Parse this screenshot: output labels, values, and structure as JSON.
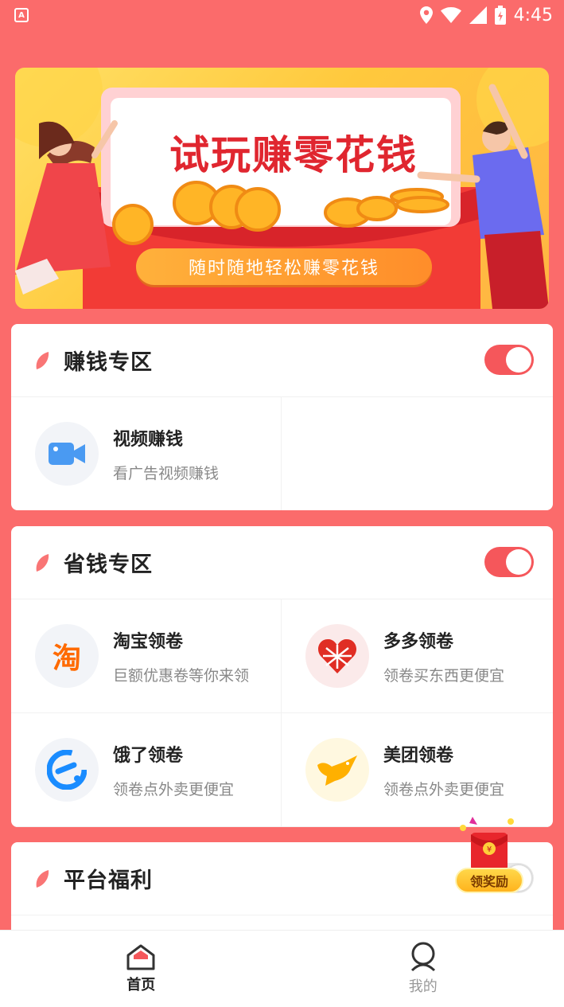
{
  "status_bar": {
    "time": "4:45",
    "app_badge": "A"
  },
  "banner": {
    "title": "试玩赚零花钱",
    "subtitle": "随时随地轻松赚零花钱"
  },
  "sections": [
    {
      "title": "赚钱专区",
      "toggle_on": true,
      "items": [
        {
          "title": "视频赚钱",
          "subtitle": "看广告视频赚钱",
          "icon": "video-camera-icon"
        }
      ]
    },
    {
      "title": "省钱专区",
      "toggle_on": true,
      "items": [
        {
          "title": "淘宝领卷",
          "subtitle": "巨额优惠卷等你来领",
          "icon": "taobao-icon",
          "glyph": "淘"
        },
        {
          "title": "多多领卷",
          "subtitle": "领卷买东西更便宜",
          "icon": "pinduoduo-icon"
        },
        {
          "title": "饿了领卷",
          "subtitle": "领卷点外卖更便宜",
          "icon": "eleme-icon"
        },
        {
          "title": "美团领卷",
          "subtitle": "领卷点外卖更便宜",
          "icon": "meituan-icon"
        }
      ]
    },
    {
      "title": "平台福利",
      "toggle_on": false,
      "items": []
    }
  ],
  "reward_float": {
    "label": "领奖励",
    "icon": "red-envelope-icon"
  },
  "bottom_nav": [
    {
      "label": "首页",
      "icon": "home-icon",
      "active": true
    },
    {
      "label": "我的",
      "icon": "user-icon",
      "active": false
    }
  ],
  "colors": {
    "accent": "#fb6b6b",
    "toggle": "#f5575b",
    "banner_title": "#e0262f"
  }
}
